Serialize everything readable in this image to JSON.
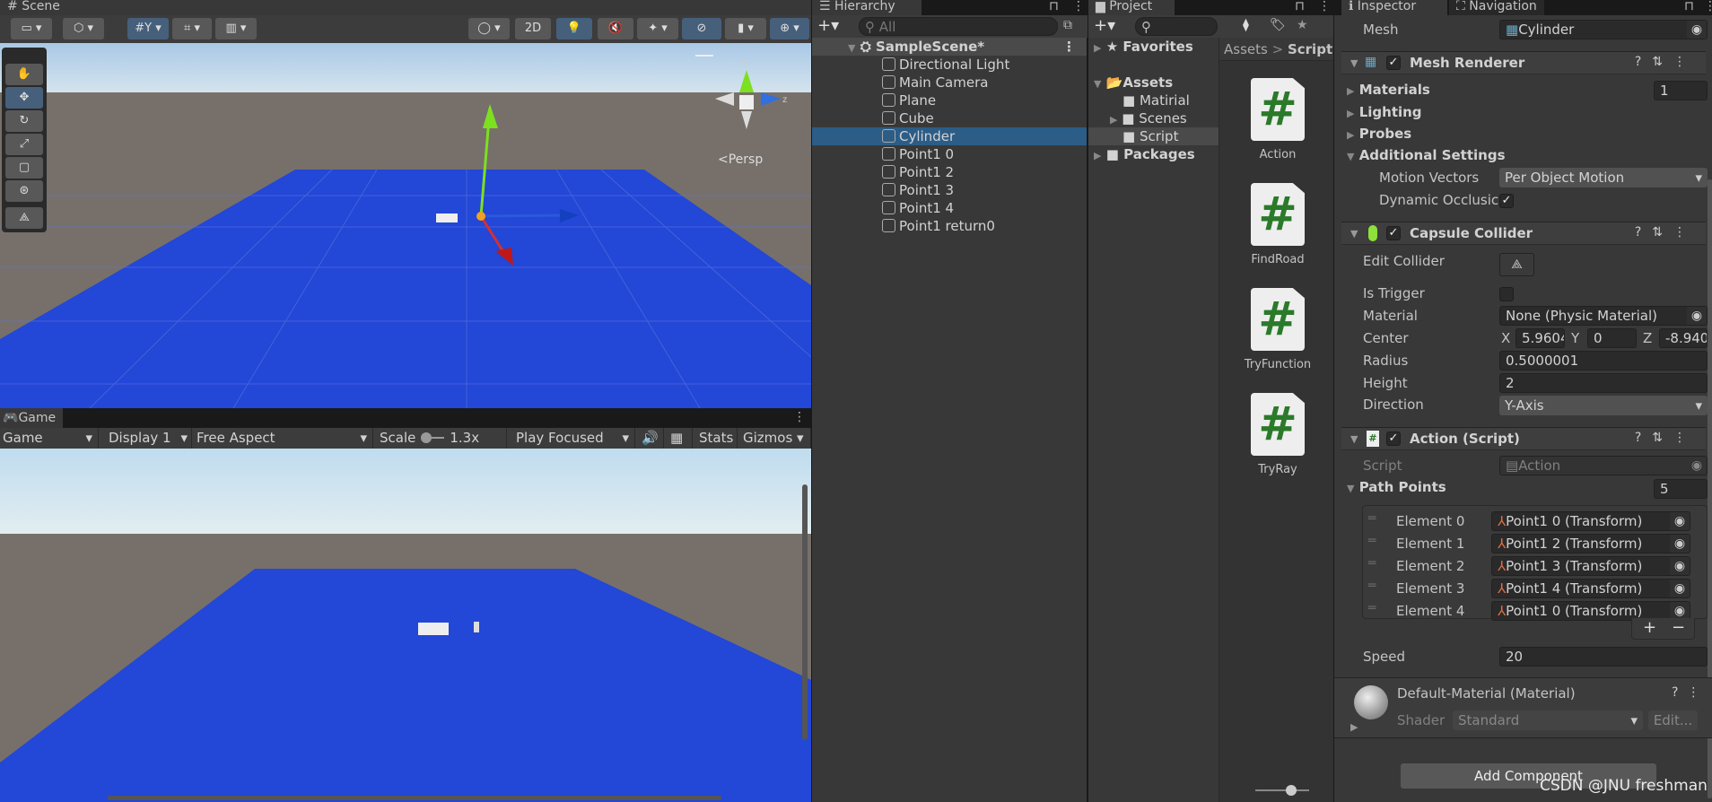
{
  "scene": {
    "tab": "Scene",
    "toolbar": {
      "two_d": "2D"
    },
    "persp_label": "<Persp",
    "gizmo_axes": {
      "y": "y",
      "z": "z"
    }
  },
  "game": {
    "tab": "Game",
    "mode": "Game",
    "display": "Display 1",
    "aspect": "Free Aspect",
    "scale_label": "Scale",
    "scale_value": "1.3x",
    "scale_fraction": 0.1,
    "play_mode": "Play Focused",
    "stats": "Stats",
    "gizmos": "Gizmos"
  },
  "hierarchy": {
    "tab": "Hierarchy",
    "search_placeholder": "All",
    "scene_name": "SampleScene*",
    "items": [
      "Directional Light",
      "Main Camera",
      "Plane",
      "Cube",
      "Cylinder",
      "Point1 0",
      "Point1 2",
      "Point1 3",
      "Point1 4",
      "Point1 return0"
    ],
    "selected": "Cylinder"
  },
  "project": {
    "tab": "Project",
    "favorites": "Favorites",
    "assets": "Assets",
    "folders": [
      "Matirial",
      "Scenes",
      "Script"
    ],
    "packages": "Packages",
    "breadcrumb": {
      "root": "Assets",
      "sep": ">",
      "current": "Script"
    },
    "files": [
      "Action",
      "FindRoad",
      "TryFunction",
      "TryRay"
    ]
  },
  "inspector": {
    "tab": "Inspector",
    "tab2": "Navigation",
    "mesh": {
      "label": "Mesh",
      "value": "Cylinder"
    },
    "mesh_renderer": {
      "title": "Mesh Renderer",
      "enabled": true,
      "materials": "Materials",
      "materials_count": "1",
      "lighting": "Lighting",
      "probes": "Probes",
      "additional": "Additional Settings",
      "motion_vectors_label": "Motion Vectors",
      "motion_vectors": "Per Object Motion",
      "dynamic_occlusion_label": "Dynamic Occlusic",
      "dynamic_occlusion": true
    },
    "capsule": {
      "title": "Capsule Collider",
      "enabled": true,
      "edit_collider": "Edit Collider",
      "is_trigger": "Is Trigger",
      "material_label": "Material",
      "material": "None (Physic Material)",
      "center_label": "Center",
      "cx": "5.9604",
      "cy": "0",
      "cz": "-8.940",
      "x": "X",
      "y": "Y",
      "z": "Z",
      "radius_label": "Radius",
      "radius": "0.5000001",
      "height_label": "Height",
      "height": "2",
      "direction_label": "Direction",
      "direction": "Y-Axis"
    },
    "action": {
      "title": "Action (Script)",
      "enabled": true,
      "script_label": "Script",
      "script": "Action",
      "path_points": "Path Points",
      "count": "5",
      "elements": [
        {
          "label": "Element 0",
          "value": "Point1 0 (Transform)"
        },
        {
          "label": "Element 1",
          "value": "Point1 2 (Transform)"
        },
        {
          "label": "Element 2",
          "value": "Point1 3 (Transform)"
        },
        {
          "label": "Element 3",
          "value": "Point1 4 (Transform)"
        },
        {
          "label": "Element 4",
          "value": "Point1 0 (Transform)"
        }
      ],
      "add": "+",
      "remove": "−",
      "speed_label": "Speed",
      "speed": "20"
    },
    "material": {
      "title": "Default-Material (Material)",
      "shader_label": "Shader",
      "shader": "Standard",
      "edit": "Edit..."
    },
    "add_component": "Add Component"
  },
  "watermark": "CSDN @JNU freshman",
  "colors": {
    "selection": "#2c5d87",
    "plane": "#2347d6",
    "panel": "#383838"
  }
}
